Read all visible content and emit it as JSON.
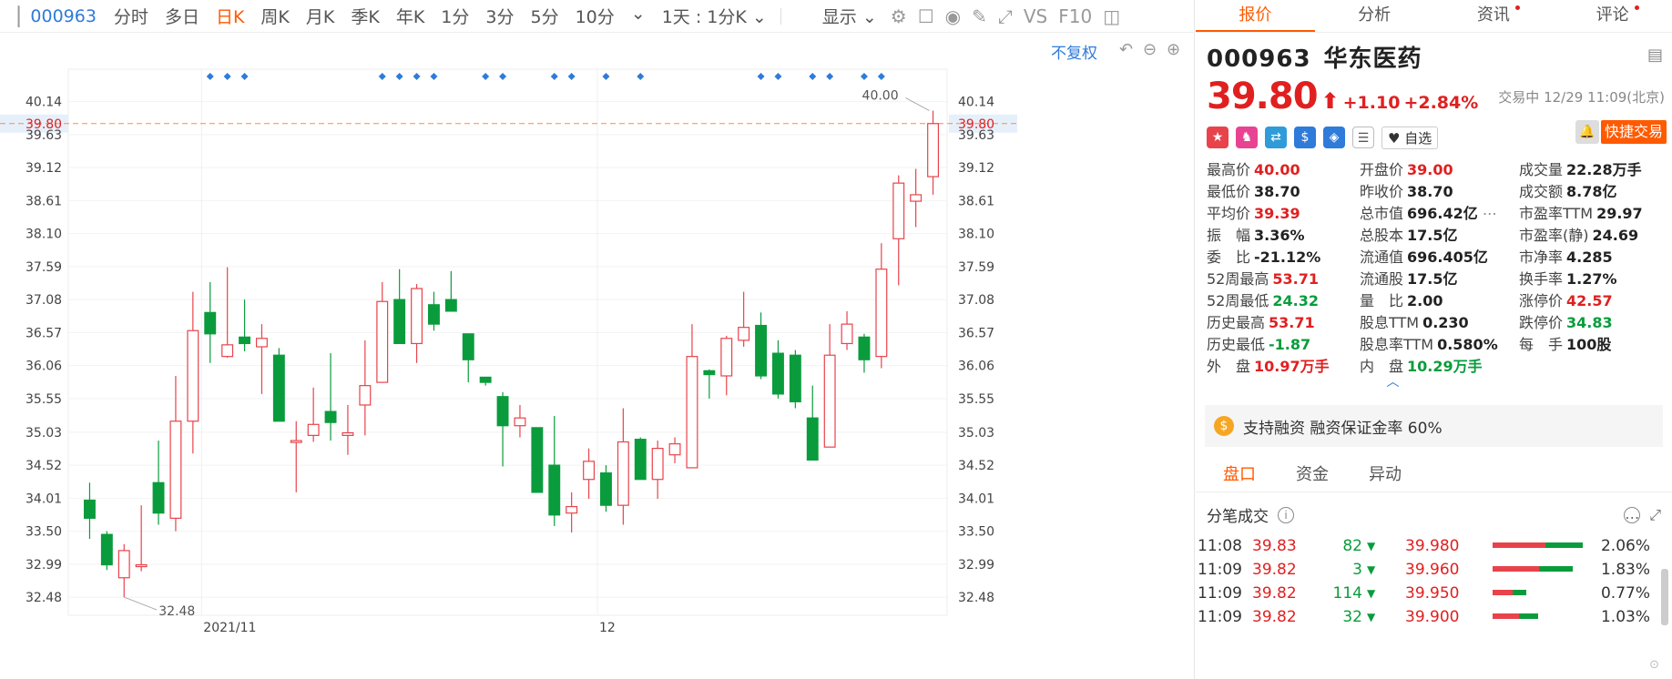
{
  "toolbar": {
    "code": "000963",
    "periods": [
      "分时",
      "多日",
      "日K",
      "周K",
      "月K",
      "季K",
      "年K",
      "1分",
      "3分",
      "5分",
      "10分"
    ],
    "active_index": 2,
    "interval": "1天 : 1分K",
    "display": "显示",
    "vs": "VS",
    "f10": "F10"
  },
  "chart": {
    "fq": "不复权",
    "price_ticks": [
      "40.14",
      "39.80",
      "39.63",
      "39.12",
      "38.61",
      "38.10",
      "37.59",
      "37.08",
      "36.57",
      "36.06",
      "35.55",
      "35.03",
      "34.52",
      "34.01",
      "33.50",
      "32.99",
      "32.48"
    ],
    "current_label": "39.80",
    "high_label": "40.00",
    "low_label": "32.48",
    "date_labels": [
      "2021/11",
      "12"
    ]
  },
  "chart_data": {
    "type": "candlestick",
    "ylim": [
      32.2,
      40.5
    ],
    "current_price": 39.8,
    "high_marker": 40.0,
    "low_marker": 32.48,
    "candles": [
      {
        "o": 33.98,
        "c": 33.7,
        "h": 34.25,
        "l": 33.38
      },
      {
        "o": 33.45,
        "c": 32.98,
        "h": 33.5,
        "l": 32.9
      },
      {
        "o": 32.78,
        "c": 33.2,
        "h": 33.3,
        "l": 32.48
      },
      {
        "o": 32.98,
        "c": 32.98,
        "h": 33.9,
        "l": 32.88
      },
      {
        "o": 34.25,
        "c": 33.78,
        "h": 34.9,
        "l": 33.6
      },
      {
        "o": 33.7,
        "c": 35.2,
        "h": 35.9,
        "l": 33.5
      },
      {
        "o": 35.2,
        "c": 36.6,
        "h": 37.2,
        "l": 34.7
      },
      {
        "o": 36.88,
        "c": 36.55,
        "h": 37.35,
        "l": 36.1
      },
      {
        "o": 36.2,
        "c": 36.38,
        "h": 37.58,
        "l": 36.18
      },
      {
        "o": 36.5,
        "c": 36.4,
        "h": 37.08,
        "l": 36.28
      },
      {
        "o": 36.35,
        "c": 36.48,
        "h": 36.7,
        "l": 35.62
      },
      {
        "o": 36.22,
        "c": 35.2,
        "h": 36.33,
        "l": 35.2
      },
      {
        "o": 34.9,
        "c": 34.9,
        "h": 35.2,
        "l": 34.1
      },
      {
        "o": 34.98,
        "c": 35.15,
        "h": 35.72,
        "l": 34.88
      },
      {
        "o": 35.35,
        "c": 35.18,
        "h": 36.25,
        "l": 34.9
      },
      {
        "o": 34.98,
        "c": 35.02,
        "h": 35.45,
        "l": 34.68
      },
      {
        "o": 35.45,
        "c": 35.75,
        "h": 36.45,
        "l": 34.98
      },
      {
        "o": 35.8,
        "c": 37.05,
        "h": 37.35,
        "l": 35.8
      },
      {
        "o": 37.08,
        "c": 36.4,
        "h": 37.55,
        "l": 36.4
      },
      {
        "o": 36.4,
        "c": 37.25,
        "h": 37.32,
        "l": 36.1
      },
      {
        "o": 37.0,
        "c": 36.7,
        "h": 37.2,
        "l": 36.6
      },
      {
        "o": 37.08,
        "c": 36.9,
        "h": 37.52,
        "l": 36.9
      },
      {
        "o": 36.55,
        "c": 36.15,
        "h": 36.55,
        "l": 35.8
      },
      {
        "o": 35.88,
        "c": 35.8,
        "h": 35.88,
        "l": 35.75
      },
      {
        "o": 35.58,
        "c": 35.13,
        "h": 35.65,
        "l": 34.5
      },
      {
        "o": 35.13,
        "c": 35.25,
        "h": 35.45,
        "l": 34.95
      },
      {
        "o": 35.1,
        "c": 34.1,
        "h": 35.1,
        "l": 34.1
      },
      {
        "o": 34.52,
        "c": 33.75,
        "h": 35.28,
        "l": 33.58
      },
      {
        "o": 33.78,
        "c": 33.88,
        "h": 34.1,
        "l": 33.48
      },
      {
        "o": 34.3,
        "c": 34.58,
        "h": 34.78,
        "l": 34.0
      },
      {
        "o": 34.4,
        "c": 33.9,
        "h": 34.52,
        "l": 33.8
      },
      {
        "o": 33.9,
        "c": 34.88,
        "h": 35.4,
        "l": 33.6
      },
      {
        "o": 34.92,
        "c": 34.3,
        "h": 34.95,
        "l": 34.3
      },
      {
        "o": 34.3,
        "c": 34.78,
        "h": 34.9,
        "l": 34.0
      },
      {
        "o": 34.68,
        "c": 34.85,
        "h": 34.95,
        "l": 34.55
      },
      {
        "o": 34.48,
        "c": 36.2,
        "h": 36.7,
        "l": 34.48
      },
      {
        "o": 35.98,
        "c": 35.92,
        "h": 36.0,
        "l": 35.55
      },
      {
        "o": 35.9,
        "c": 36.48,
        "h": 36.52,
        "l": 35.6
      },
      {
        "o": 36.45,
        "c": 36.65,
        "h": 37.2,
        "l": 36.35
      },
      {
        "o": 36.68,
        "c": 35.9,
        "h": 36.88,
        "l": 35.85
      },
      {
        "o": 36.25,
        "c": 35.62,
        "h": 36.45,
        "l": 35.55
      },
      {
        "o": 36.22,
        "c": 35.5,
        "h": 36.3,
        "l": 35.4
      },
      {
        "o": 35.25,
        "c": 34.6,
        "h": 35.75,
        "l": 34.6
      },
      {
        "o": 34.8,
        "c": 36.22,
        "h": 36.7,
        "l": 34.8
      },
      {
        "o": 36.4,
        "c": 36.7,
        "h": 36.9,
        "l": 36.3
      },
      {
        "o": 36.5,
        "c": 36.15,
        "h": 36.55,
        "l": 35.95
      },
      {
        "o": 36.2,
        "c": 37.55,
        "h": 37.95,
        "l": 36.02
      },
      {
        "o": 38.02,
        "c": 38.88,
        "h": 39.0,
        "l": 37.3
      },
      {
        "o": 38.6,
        "c": 38.7,
        "h": 39.1,
        "l": 38.2
      },
      {
        "o": 38.98,
        "c": 39.8,
        "h": 40.0,
        "l": 38.7
      }
    ],
    "markers": [
      7,
      8,
      9,
      17,
      18,
      19,
      20,
      23,
      24,
      27,
      28,
      30,
      32,
      39,
      40,
      42,
      43,
      45,
      46
    ]
  },
  "quote": {
    "tabs": [
      "报价",
      "分析",
      "资讯",
      "评论"
    ],
    "code": "000963",
    "name": "华东医药",
    "price": "39.80",
    "arrow": "⬆",
    "change": "+1.10",
    "change_pct": "+2.84%",
    "status": "交易中 12/29 11:09(北京)",
    "fav": "自选",
    "quick_trade": "快捷交易",
    "stats": [
      {
        "label": "最高价",
        "value": "40.00",
        "color": "r"
      },
      {
        "label": "开盘价",
        "value": "39.00",
        "color": "r"
      },
      {
        "label": "成交量",
        "value": "22.28万手",
        "color": "k"
      },
      {
        "label": "最低价",
        "value": "38.70",
        "color": "k"
      },
      {
        "label": "昨收价",
        "value": "38.70",
        "color": "k"
      },
      {
        "label": "成交额",
        "value": "8.78亿",
        "color": "k"
      },
      {
        "label": "平均价",
        "value": "39.39",
        "color": "r"
      },
      {
        "label": "总市值",
        "value": "696.42亿",
        "color": "k"
      },
      {
        "label": "市盈率TTM",
        "value": "29.97",
        "color": "k"
      },
      {
        "label": "振　幅",
        "value": "3.36%",
        "color": "k"
      },
      {
        "label": "总股本",
        "value": "17.5亿",
        "color": "k"
      },
      {
        "label": "市盈率(静)",
        "value": "24.69",
        "color": "k"
      },
      {
        "label": "委　比",
        "value": "-21.12%",
        "color": "k"
      },
      {
        "label": "流通值",
        "value": "696.405亿",
        "color": "k"
      },
      {
        "label": "市净率",
        "value": "4.285",
        "color": "k"
      },
      {
        "label": "52周最高",
        "value": "53.71",
        "color": "r"
      },
      {
        "label": "流通股",
        "value": "17.5亿",
        "color": "k"
      },
      {
        "label": "换手率",
        "value": "1.27%",
        "color": "k"
      },
      {
        "label": "52周最低",
        "value": "24.32",
        "color": "g"
      },
      {
        "label": "量　比",
        "value": "2.00",
        "color": "k"
      },
      {
        "label": "涨停价",
        "value": "42.57",
        "color": "r"
      },
      {
        "label": "历史最高",
        "value": "53.71",
        "color": "r"
      },
      {
        "label": "股息TTM",
        "value": "0.230",
        "color": "k"
      },
      {
        "label": "跌停价",
        "value": "34.83",
        "color": "g"
      },
      {
        "label": "历史最低",
        "value": "-1.87",
        "color": "g"
      },
      {
        "label": "股息率TTM",
        "value": "0.580%",
        "color": "k"
      },
      {
        "label": "每　手",
        "value": "100股",
        "color": "k"
      },
      {
        "label": "外　盘",
        "value": "10.97万手",
        "color": "r"
      },
      {
        "label": "内　盘",
        "value": "10.29万手",
        "color": "g"
      }
    ],
    "margin": "支持融资 融资保证金率 60%",
    "tabs2": [
      "盘口",
      "资金",
      "异动"
    ],
    "ticks_title": "分笔成交",
    "ticks": [
      {
        "time": "11:08",
        "price": "39.83",
        "vol": "82",
        "dir": "▼"
      },
      {
        "time": "11:09",
        "price": "39.82",
        "vol": "3",
        "dir": "▼"
      },
      {
        "time": "11:09",
        "price": "39.82",
        "vol": "114",
        "dir": "▼"
      },
      {
        "time": "11:09",
        "price": "39.82",
        "vol": "32",
        "dir": "▼"
      }
    ],
    "depth": [
      {
        "price": "39.980",
        "pct": "2.06%",
        "share": 0.0206
      },
      {
        "price": "39.960",
        "pct": "1.83%",
        "share": 0.0183
      },
      {
        "price": "39.950",
        "pct": "0.77%",
        "share": 0.0077
      },
      {
        "price": "39.900",
        "pct": "1.03%",
        "share": 0.0103
      }
    ]
  },
  "colors": {
    "up": "#e8434b",
    "down": "#0a9c3c",
    "accent": "#ff5a00",
    "blue": "#2f7bd9"
  }
}
